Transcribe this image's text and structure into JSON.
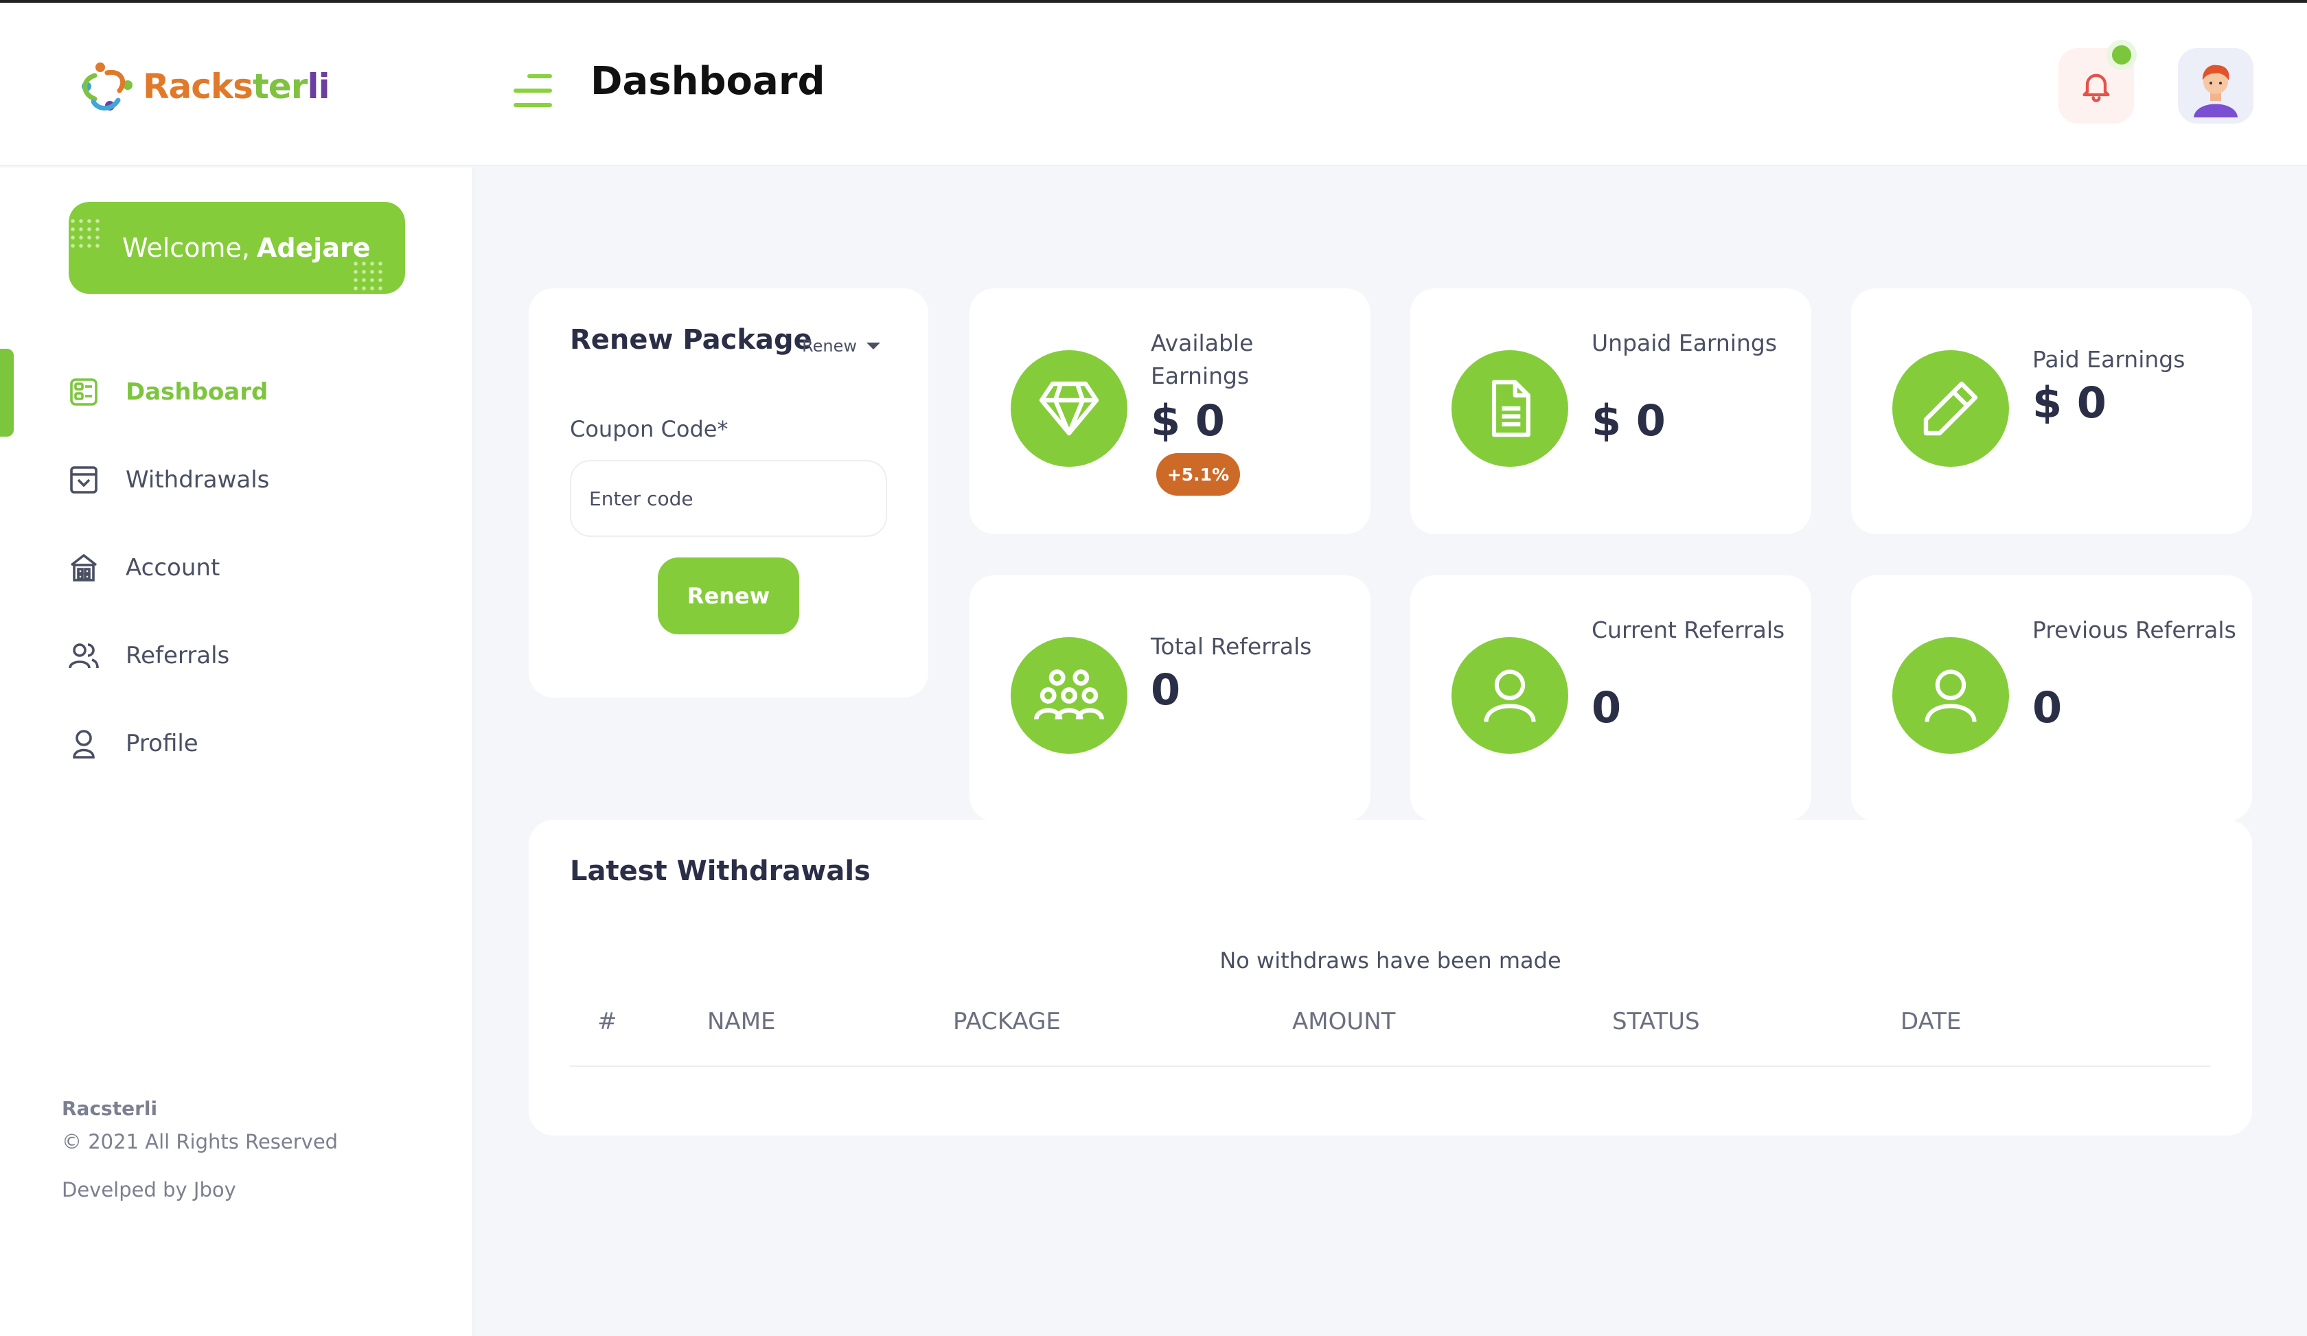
{
  "brand": {
    "logo_text_1": "Racks",
    "logo_text_2": "ter",
    "logo_text_3": "li"
  },
  "header": {
    "title": "Dashboard",
    "notification_status_color": "#7cc63d"
  },
  "sidebar": {
    "welcome_prefix": "Welcome,",
    "welcome_name": "Adejare",
    "items": [
      {
        "label": "Dashboard",
        "icon": "dashboard-icon",
        "active": true
      },
      {
        "label": "Withdrawals",
        "icon": "archive-box-icon",
        "active": false
      },
      {
        "label": "Account",
        "icon": "bank-icon",
        "active": false
      },
      {
        "label": "Referrals",
        "icon": "users-icon",
        "active": false
      },
      {
        "label": "Profile",
        "icon": "user-icon",
        "active": false
      }
    ],
    "footer": {
      "brand": "Racsterli",
      "copyright": "© 2021 All Rights Reserved",
      "developer": "Develped by Jboy"
    }
  },
  "renew": {
    "title": "Renew Package",
    "select_value": "Renew",
    "coupon_label": "Coupon Code*",
    "coupon_placeholder": "Enter code",
    "coupon_value": "",
    "button_label": "Renew"
  },
  "stats": [
    {
      "label": "Available Earnings",
      "value": "$ 0",
      "icon": "diamond-icon",
      "badge": "+5.1%"
    },
    {
      "label": "Unpaid Earnings",
      "value": "$ 0",
      "icon": "document-icon"
    },
    {
      "label": "Paid Earnings",
      "value": "$ 0",
      "icon": "pencil-icon"
    },
    {
      "label": "Total Referrals",
      "value": "0",
      "icon": "group-icon"
    },
    {
      "label": "Current Referrals",
      "value": "0",
      "icon": "user-icon"
    },
    {
      "label": "Previous Referrals",
      "value": "0",
      "icon": "user-icon"
    }
  ],
  "withdrawals": {
    "title": "Latest Withdrawals",
    "empty_message": "No withdraws have been made",
    "columns": [
      "#",
      "NAME",
      "PACKAGE",
      "AMOUNT",
      "STATUS",
      "DATE"
    ],
    "rows": []
  },
  "colors": {
    "accent": "#85cc3b",
    "badge": "#cd6a28",
    "text_dark": "#2a2e46"
  }
}
